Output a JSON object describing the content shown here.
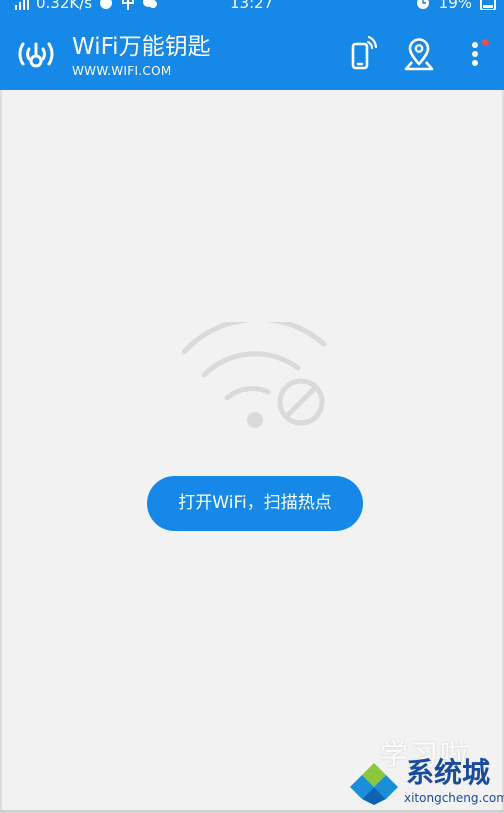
{
  "status_bar": {
    "network_speed": "0.32K/s",
    "time": "13:27",
    "battery": "19%"
  },
  "app_bar": {
    "title": "WiFi万能钥匙",
    "subtitle": "WWW.WIFI.COM",
    "icons": [
      "wifi-key-logo-icon",
      "phone-share-icon",
      "location-icon",
      "more-icon"
    ]
  },
  "main": {
    "status_icon": "wifi-off-icon",
    "scan_button_label": "打开WiFi，扫描热点"
  },
  "watermark": {
    "faded_text": "学习啦",
    "brand": "系统城",
    "url": "xitongcheng.com"
  },
  "colors": {
    "primary": "#1588e8",
    "background": "#f2f2f2",
    "icon_gray": "#dadada",
    "badge_red": "#f24b4b",
    "watermark_blue": "#1a4c9e"
  }
}
